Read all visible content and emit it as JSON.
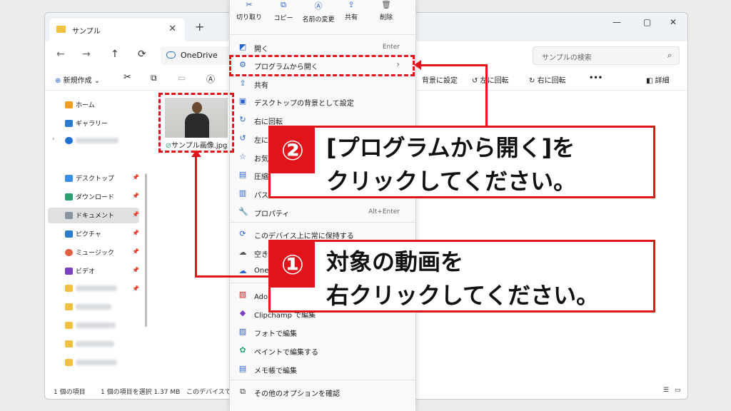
{
  "window": {
    "tab_title": "サンプル",
    "tab_close": "✕",
    "new_tab": "+",
    "minimize": "—",
    "maximize": "▢",
    "close": "✕"
  },
  "nav": {
    "back": "←",
    "forward": "→",
    "up": "↑",
    "refresh": "⟳",
    "address": "OneDrive",
    "search_placeholder": "サンプルの検索",
    "search_icon": "⌕"
  },
  "toolbar": {
    "new": "新規作成",
    "set_bg": "背景に設定",
    "rotate_left": "左に回転",
    "rotate_right": "右に回転",
    "more": "•••",
    "details": "詳細"
  },
  "sidebar": {
    "home": "ホーム",
    "gallery": "ギャラリー",
    "desktop": "デスクトップ",
    "downloads": "ダウンロード",
    "documents": "ドキュメント",
    "pictures": "ピクチャ",
    "music": "ミュージック",
    "videos": "ビデオ"
  },
  "file": {
    "name": "サンプル画像.jpg"
  },
  "status": {
    "count": "1 個の項目",
    "selected": "1 個の項目を選択 1.37 MB",
    "available": "このデバイスで使"
  },
  "context_menu": {
    "quick": {
      "cut": "切り取り",
      "copy": "コピー",
      "rename": "名前の変更",
      "share": "共有",
      "delete": "削除"
    },
    "open": "開く",
    "open_shortcut": "Enter",
    "open_with": "プログラムから開く",
    "open_with_arrow": "›",
    "share": "共有",
    "desktop_bg": "デスクトップの背景として設定",
    "rotate_right": "右に回転",
    "rotate_left": "左に",
    "favorite": "お気",
    "compress": "圧縮",
    "copy_path": "パス",
    "properties": "プロパティ",
    "properties_shortcut": "Alt+Enter",
    "always_keep": "このデバイス上に常に保持する",
    "free_space": "空き",
    "onedrive": "One",
    "adobe": "Adobe PDF に変換",
    "clipchamp": "Clipchamp で編集",
    "photos": "フォトで編集",
    "paint": "ペイントで編集する",
    "notepad": "メモ帳で編集",
    "more_options": "その他のオプションを確認"
  },
  "callouts": {
    "step1_num": "①",
    "step1_line1": "対象の動画を",
    "step1_line2": "右クリックしてください。",
    "step2_num": "②",
    "step2_line1": "[プログラムから開く]を",
    "step2_line2": "クリックしてください。"
  },
  "colors": {
    "accent_red": "#e0141a",
    "accent_blue": "#2a63c9"
  }
}
